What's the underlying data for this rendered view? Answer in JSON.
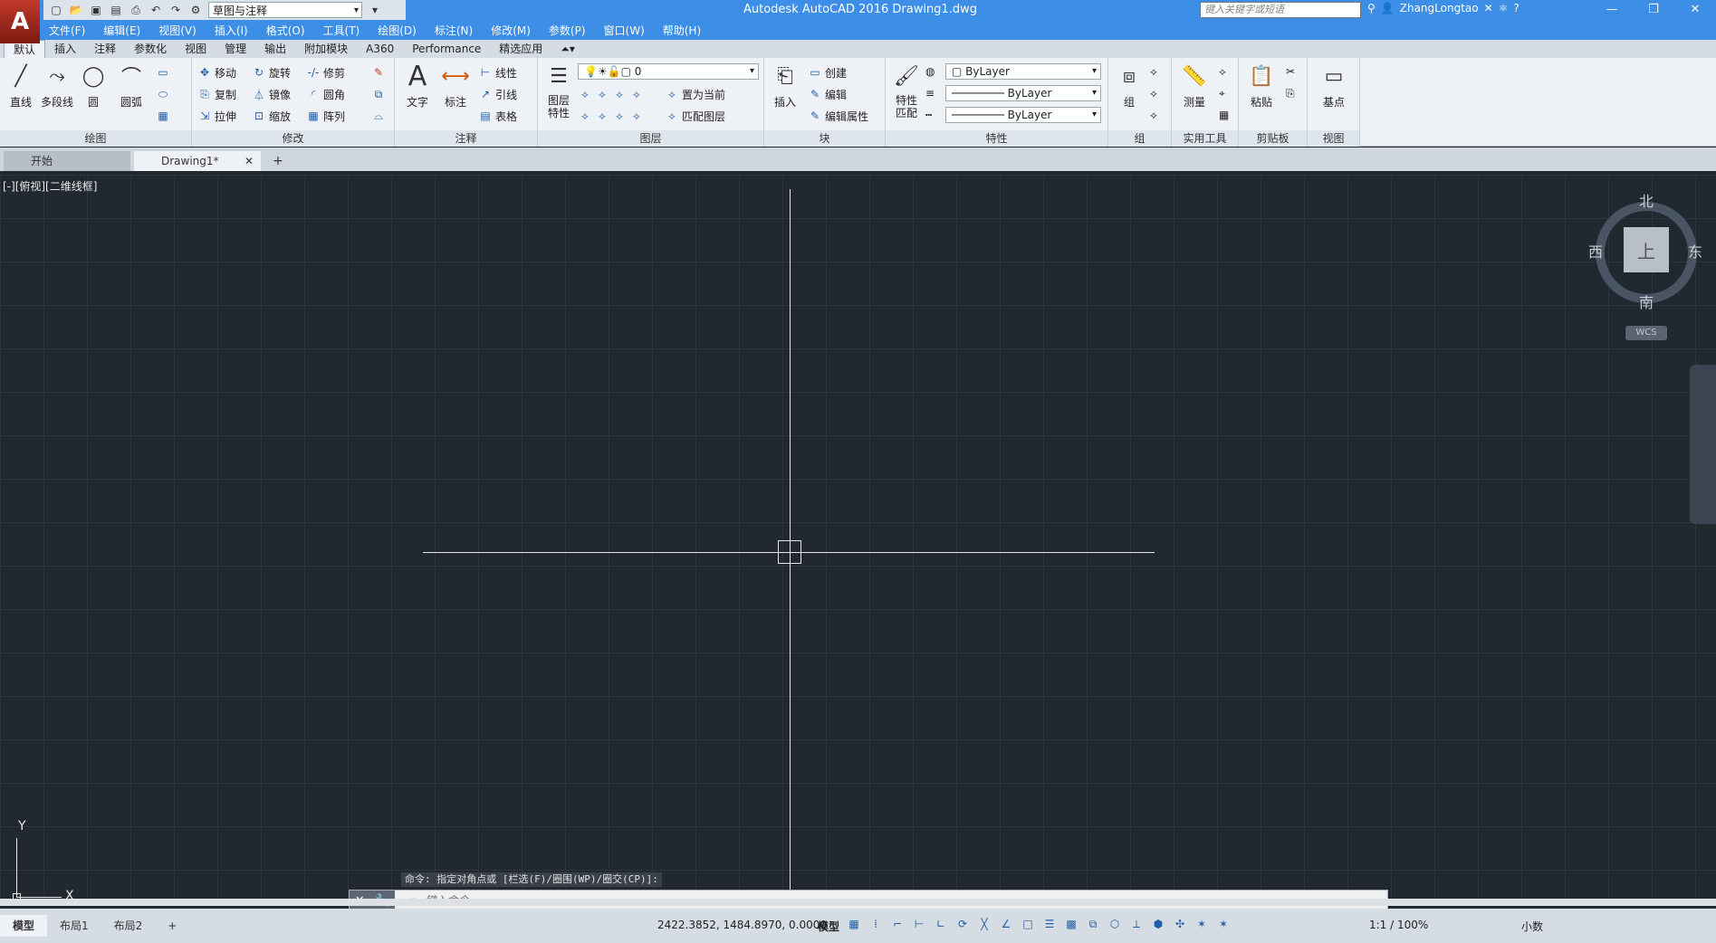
{
  "app": {
    "logo_letter": "A",
    "title": "Autodesk AutoCAD 2016    Drawing1.dwg",
    "workspace": "草图与注释",
    "search_placeholder": "键入关键字或短语",
    "user": "ZhangLongtao"
  },
  "menu": [
    "文件(F)",
    "编辑(E)",
    "视图(V)",
    "插入(I)",
    "格式(O)",
    "工具(T)",
    "绘图(D)",
    "标注(N)",
    "修改(M)",
    "参数(P)",
    "窗口(W)",
    "帮助(H)"
  ],
  "ribbon_tabs": [
    "默认",
    "插入",
    "注释",
    "参数化",
    "视图",
    "管理",
    "输出",
    "附加模块",
    "A360",
    "Performance",
    "精选应用"
  ],
  "panels": {
    "draw": {
      "title": "绘图",
      "line": "直线",
      "polyline": "多段线",
      "circle": "圆",
      "arc": "圆弧"
    },
    "modify": {
      "title": "修改",
      "move": "移动",
      "rotate": "旋转",
      "trim": "修剪",
      "copy": "复制",
      "mirror": "镜像",
      "fillet": "圆角",
      "stretch": "拉伸",
      "scale": "缩放",
      "array": "阵列"
    },
    "annotation": {
      "title": "注释",
      "text": "文字",
      "dimension": "标注",
      "linear": "线性",
      "leader": "引线",
      "table": "表格"
    },
    "layers": {
      "title": "图层",
      "properties": "图层",
      "properties2": "特性",
      "current_layer": "0",
      "set_current": "置为当前",
      "match_layer": "匹配图层"
    },
    "block": {
      "title": "块",
      "insert": "插入",
      "create": "创建",
      "edit": "编辑",
      "edit_attr": "编辑属性"
    },
    "properties": {
      "title": "特性",
      "match": "特性",
      "match2": "匹配",
      "color": "ByLayer",
      "linetype": "ByLayer",
      "lineweight": "ByLayer"
    },
    "groups": {
      "title": "组",
      "group": "组"
    },
    "utilities": {
      "title": "实用工具",
      "measure": "测量"
    },
    "clipboard": {
      "title": "剪贴板",
      "paste": "粘贴"
    },
    "view": {
      "title": "视图",
      "base": "基点"
    }
  },
  "doc_tabs": {
    "start": "开始",
    "drawing": "Drawing1*"
  },
  "canvas": {
    "view_label": "[-][俯视][二维线框]",
    "compass": {
      "north": "北",
      "south": "南",
      "east": "东",
      "west": "西",
      "top": "上"
    },
    "wcs": "WCS",
    "ucs_x": "X",
    "ucs_y": "Y"
  },
  "command": {
    "history": "命令: 指定对角点或 [栏选(F)/圈围(WP)/圈交(CP)]:",
    "placeholder": "键入命令"
  },
  "status": {
    "layouts": [
      "模型",
      "布局1",
      "布局2"
    ],
    "coords": "2422.3852, 1484.8970, 0.0000",
    "model": "模型",
    "scale": "1:1 / 100%",
    "units": "小数"
  }
}
